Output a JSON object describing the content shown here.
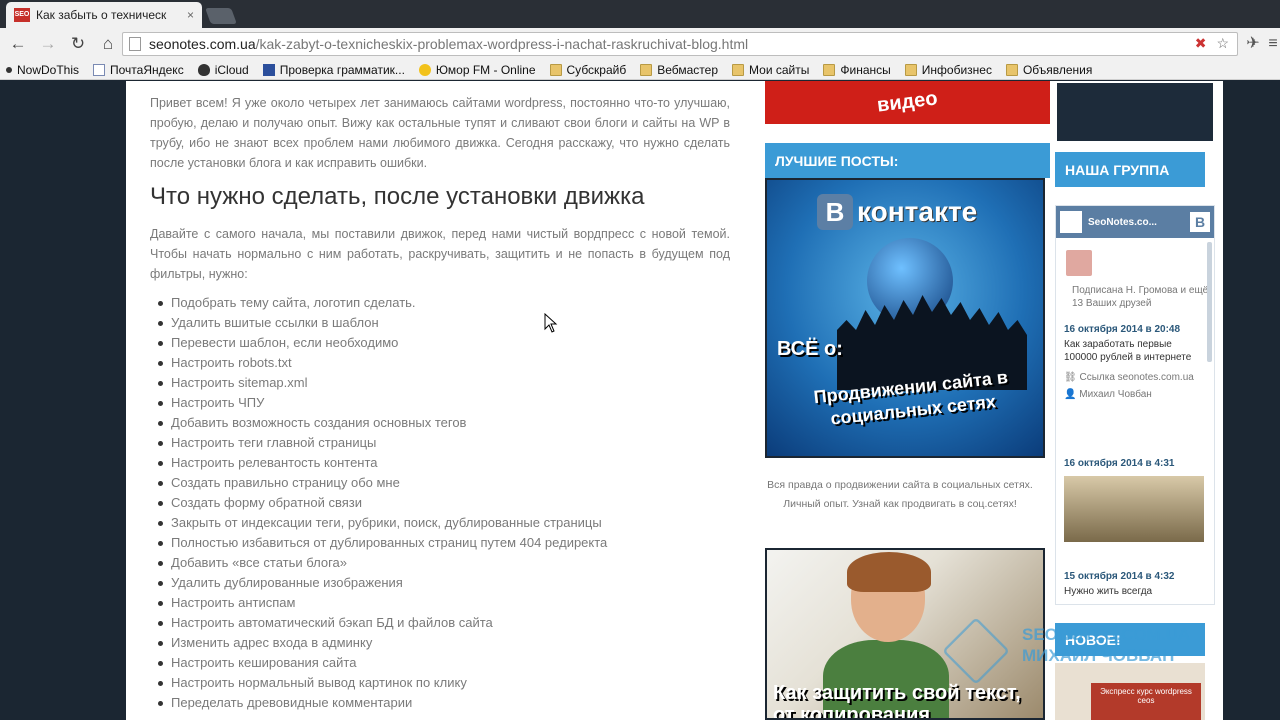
{
  "browser": {
    "tab_title": "Как забыть о техническ",
    "tab_close": "×",
    "url_host": "seonotes.com.ua",
    "url_path": "/kak-zabyt-o-texnicheskix-problemax-wordpress-i-nachat-raskruchivat-blog.html",
    "nav_back": "←",
    "nav_forward": "→",
    "nav_reload": "↻",
    "nav_home": "⌂",
    "omni_icon1": "✖",
    "omni_icon2": "☆",
    "ext1": "✈",
    "ext2": "≡"
  },
  "bookmarks": [
    {
      "label": "NowDoThis",
      "icon": "dot"
    },
    {
      "label": "ПочтаЯндекс",
      "icon": "page"
    },
    {
      "label": "iCloud",
      "icon": "apple"
    },
    {
      "label": "Проверка грамматик...",
      "icon": "blue"
    },
    {
      "label": "Юмор FM - Online",
      "icon": "yellow"
    },
    {
      "label": "Субскрайб",
      "icon": "folder"
    },
    {
      "label": "Вебмастер",
      "icon": "folder"
    },
    {
      "label": "Мои сайты",
      "icon": "folder"
    },
    {
      "label": "Финансы",
      "icon": "folder"
    },
    {
      "label": "Инфобизнес",
      "icon": "folder"
    },
    {
      "label": "Объявления",
      "icon": "folder"
    }
  ],
  "article": {
    "intro": "Привет всем! Я уже около четырех лет занимаюсь сайтами wordpress, постоянно что-то улучшаю, пробую, делаю и получаю опыт. Вижу как остальные тупят и сливают свои блоги и сайты на WP в трубу, ибо не знают всех проблем нами любимого движка. Сегодня расскажу, что нужно сделать после установки блога и как исправить ошибки.",
    "heading": "Что нужно сделать, после установки движка",
    "para": "Давайте с самого начала, мы поставили движок, перед нами чистый вордпресс с новой темой. Чтобы начать нормально с ним работать, раскручивать, защитить и не попасть в будущем под фильтры, нужно:",
    "items": [
      "Подобрать тему сайта, логотип сделать.",
      "Удалить вшитые ссылки в шаблон",
      "Перевести шаблон, если необходимо",
      "Настроить robots.txt",
      "Настроить sitemap.xml",
      "Настроить ЧПУ",
      "Добавить возможность создания основных тегов",
      "Настроить теги главной страницы",
      "Настроить релевантость контента",
      "Создать правильно страницу обо мне",
      "Создать форму обратной связи",
      "Закрыть от индексации теги, рубрики, поиск, дублированные страницы",
      "Полностью избавиться от дублированных страниц путем 404 редиректа",
      "Добавить «все статьи блога»",
      "Удалить дублированные изображения",
      "Настроить антиспам",
      "Настроить автоматический бэкап БД и файлов сайта",
      "Изменить адрес входа в админку",
      "Настроить кеширования сайта",
      "Настроить нормальный вывод картинок по клику",
      "Переделать древовидные комментарии"
    ]
  },
  "sidebar_mid": {
    "video_banner": "видео",
    "best_posts_title": "ЛУЧШИЕ ПОСТЫ:",
    "vk_b": "B",
    "vk_word": "контакте",
    "vk_text1": "ВСЁ о:",
    "vk_text2": "Продвижении сайта в социальных сетях",
    "vk_caption": "Вся правда о продвижении сайта в социальных сетях. Личный опыт. Узнай как продвигать в соц.сетях!",
    "photo_text": "Как защитить свой текст, от копирования"
  },
  "watermark": {
    "line1": "SEONOTES.COM.UA",
    "line2": "МИХАИЛ ЧОВБАН"
  },
  "sidebar_right": {
    "group_title": "НАША ГРУППА",
    "vk_widget_name": "SeoNotes.co...",
    "vk_widget_b": "B",
    "subscribed": "Подписана Н. Громова и ещё 13 Ваших друзей",
    "post1_date": "16 октября 2014 в 20:48",
    "post1_text": "Как заработать первые 100000 рублей в интернете",
    "post1_link": "Ссылка seonotes.com.ua",
    "post1_author": "Михаил Човбан",
    "post2_date": "16 октября 2014 в 4:31",
    "post3_date": "15 октября 2014 в 4:32",
    "post3_text": "Нужно жить всегда",
    "new_title": "НОВОЕ!",
    "new_book": "Экспресс курс wordpress сеos"
  },
  "colors": {
    "accent_blue": "#3b9bd6",
    "banner_red": "#cf1f18",
    "page_bg": "#1b2632"
  }
}
